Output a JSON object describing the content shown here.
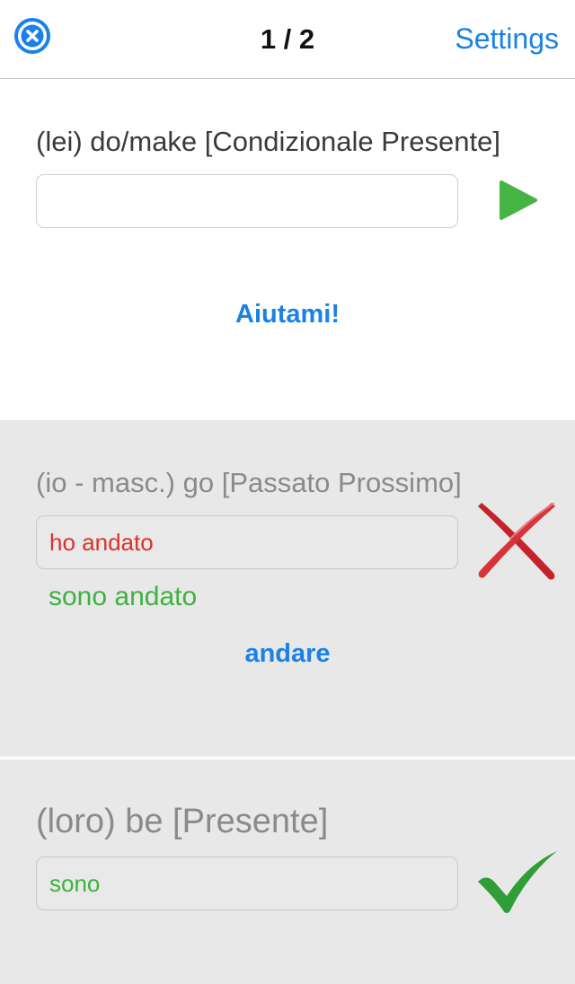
{
  "nav": {
    "close_icon": "close-circle-icon",
    "progress": "1 / 2",
    "settings_label": "Settings",
    "accent_color": "#1a82e6"
  },
  "questions": [
    {
      "prompt": "(lei) do/make [Condizionale Presente]",
      "answer_value": "",
      "submit_icon": "play-icon",
      "help_label": "Aiutami!"
    },
    {
      "prompt": "(io - masc.) go [Passato Prossimo]",
      "answer_value": "ho andato",
      "status": "wrong",
      "status_icon": "cross-icon",
      "correct_answer": "sono andato",
      "infinitive_link": "andare"
    },
    {
      "prompt": "(loro) be [Presente]",
      "answer_value": "sono",
      "status": "correct",
      "status_icon": "checkmark-icon"
    }
  ],
  "colors": {
    "wrong": "#d9332b",
    "correct": "#3db33d",
    "completed_background": "#e8e8e8"
  }
}
